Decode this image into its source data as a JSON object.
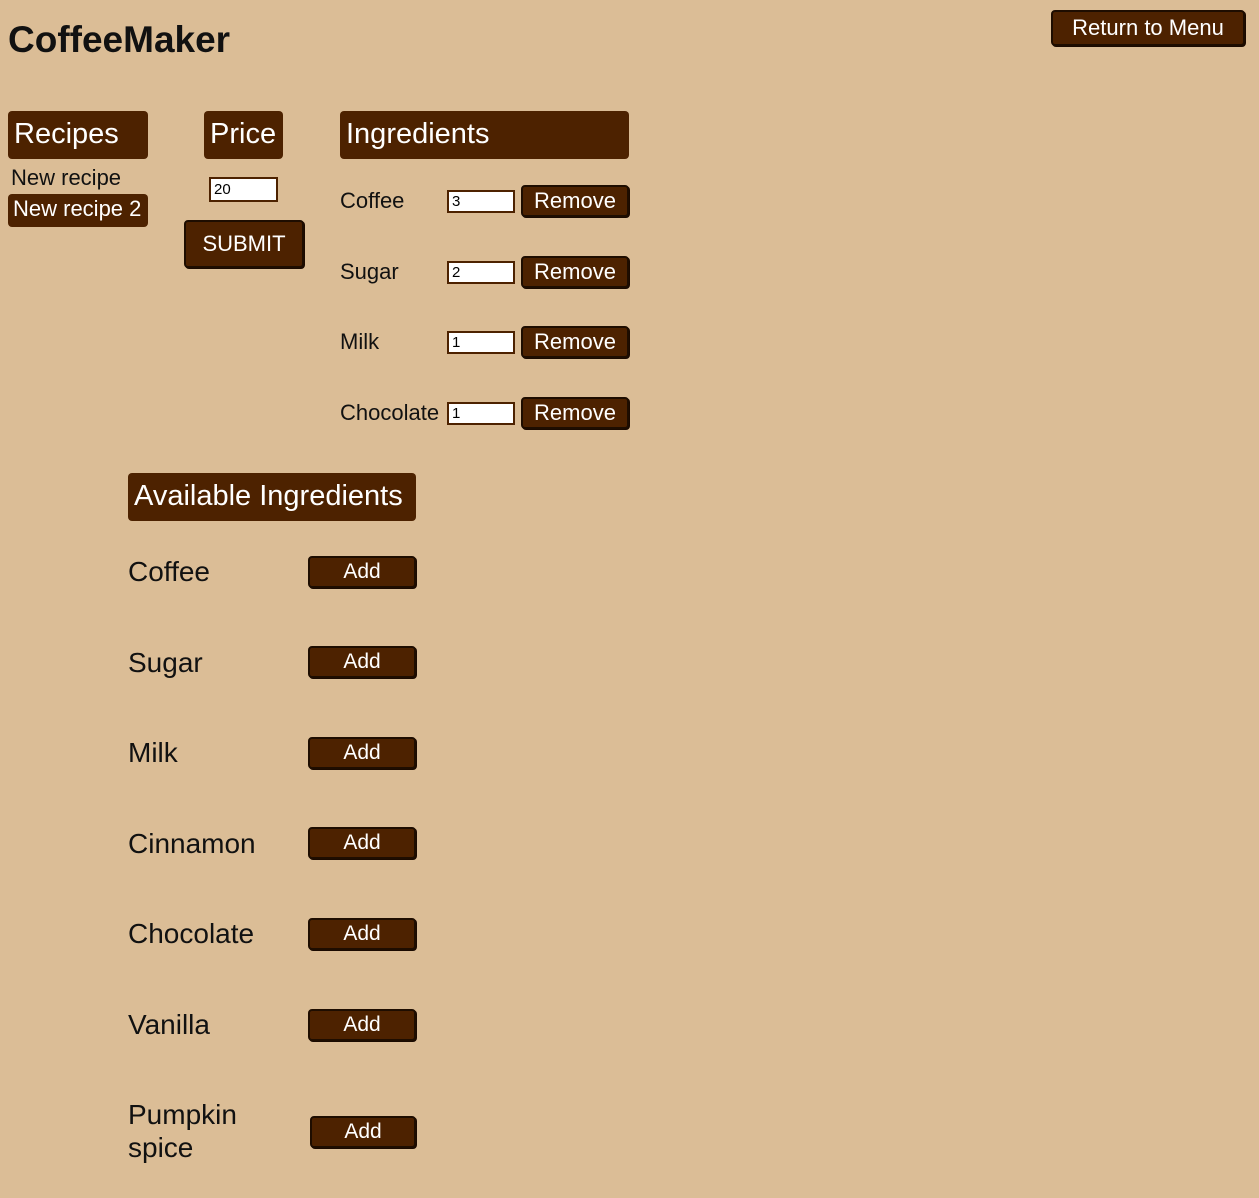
{
  "app": {
    "title": "CoffeeMaker",
    "return_label": "Return to Menu"
  },
  "recipes": {
    "header": "Recipes",
    "items": [
      {
        "label": "New recipe",
        "selected": false
      },
      {
        "label": "New recipe 2",
        "selected": true
      }
    ]
  },
  "price": {
    "header": "Price",
    "value": "20",
    "submit_label": "SUBMIT"
  },
  "ingredients": {
    "header": "Ingredients",
    "items": [
      {
        "name": "Coffee",
        "amount": "3",
        "remove_label": "Remove"
      },
      {
        "name": "Sugar",
        "amount": "2",
        "remove_label": "Remove"
      },
      {
        "name": "Milk",
        "amount": "1",
        "remove_label": "Remove"
      },
      {
        "name": "Chocolate",
        "amount": "1",
        "remove_label": "Remove"
      }
    ]
  },
  "available": {
    "header": "Available Ingredients",
    "items": [
      {
        "name": "Coffee",
        "add_label": "Add"
      },
      {
        "name": "Sugar",
        "add_label": "Add"
      },
      {
        "name": "Milk",
        "add_label": "Add"
      },
      {
        "name": "Cinnamon",
        "add_label": "Add"
      },
      {
        "name": "Chocolate",
        "add_label": "Add"
      },
      {
        "name": "Vanilla",
        "add_label": "Add"
      },
      {
        "name": "Pumpkin spice",
        "add_label": "Add"
      }
    ]
  },
  "colors": {
    "background": "#dbbd96",
    "accent": "#4d2200"
  }
}
